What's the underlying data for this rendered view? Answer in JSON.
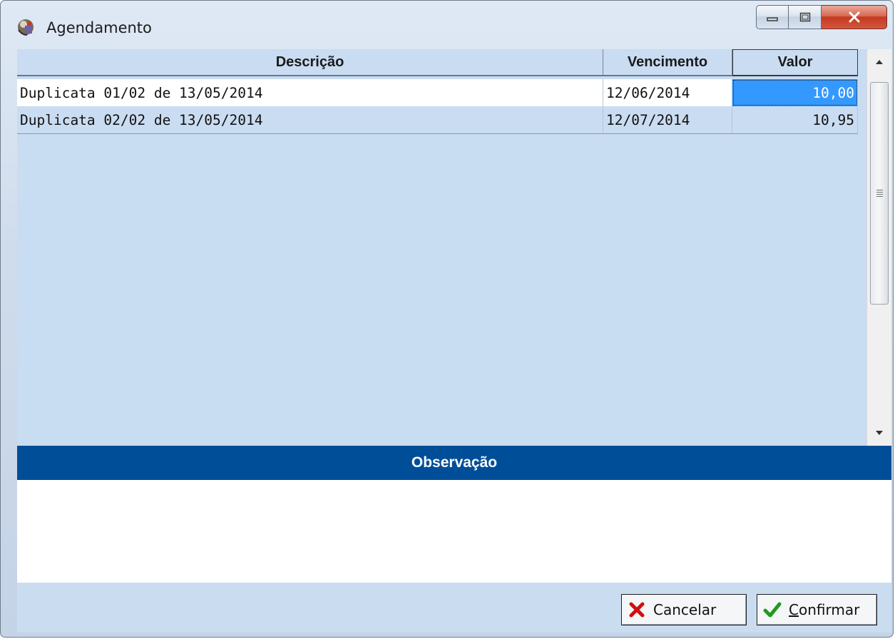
{
  "window": {
    "title": "Agendamento",
    "caption_buttons": [
      "minimize-icon",
      "maximize-icon",
      "close-icon"
    ]
  },
  "grid": {
    "columns": [
      "Descrição",
      "Vencimento",
      "Valor"
    ],
    "rows": [
      {
        "descricao": "Duplicata 01/02 de 13/05/2014",
        "vencimento": "12/06/2014",
        "valor": "10,00",
        "selected_cell": "valor"
      },
      {
        "descricao": "Duplicata 02/02 de 13/05/2014",
        "vencimento": "12/07/2014",
        "valor": "10,95"
      }
    ]
  },
  "observacao": {
    "label": "Observação",
    "value": ""
  },
  "buttons": {
    "cancel": {
      "label": "Cancelar",
      "icon": "red-x-icon"
    },
    "confirm": {
      "label": "Confirmar",
      "icon": "green-check-icon"
    }
  },
  "colors": {
    "grid_background": "#c8dcf2",
    "selection": "#3399ff",
    "observacao_header": "#004e98"
  }
}
